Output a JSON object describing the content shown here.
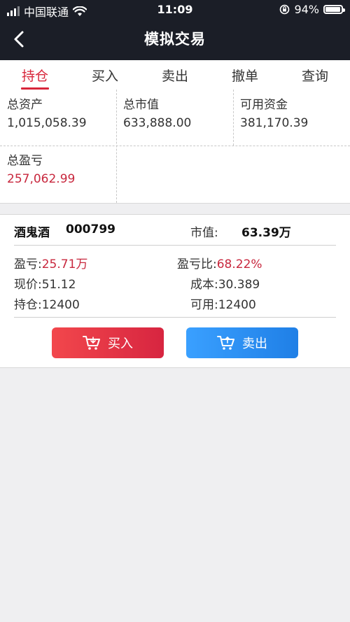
{
  "status_bar": {
    "carrier": "中国联通",
    "time": "11:09",
    "battery_percent": "94%",
    "battery_level": 0.94
  },
  "nav": {
    "title": "模拟交易",
    "back_icon": "chevron-left-icon"
  },
  "tabs": [
    {
      "label": "持仓",
      "active": true
    },
    {
      "label": "买入",
      "active": false
    },
    {
      "label": "卖出",
      "active": false
    },
    {
      "label": "撤单",
      "active": false
    },
    {
      "label": "查询",
      "active": false
    }
  ],
  "account": {
    "total_assets_label": "总资产",
    "total_assets_value": "1,015,058.39",
    "market_value_label": "总市值",
    "market_value_value": "633,888.00",
    "available_funds_label": "可用资金",
    "available_funds_value": "381,170.39",
    "total_pnl_label": "总盈亏",
    "total_pnl_value": "257,062.99"
  },
  "position": {
    "stock_name": "酒鬼酒",
    "stock_code": "000799",
    "market_value_label": "市值:",
    "market_value": "63.39万",
    "pnl_label": "盈亏:",
    "pnl_value": "25.71万",
    "pnl_ratio_label": "盈亏比:",
    "pnl_ratio_value": "68.22%",
    "price_label": "现价:",
    "price_value": "51.12",
    "cost_label": "成本:",
    "cost_value": "30.389",
    "holding_label": "持仓:",
    "holding_value": "12400",
    "available_label": "可用:",
    "available_value": "12400",
    "buy_label": "买入",
    "sell_label": "卖出"
  },
  "colors": {
    "accent_red": "#d8263b",
    "loss_gain_red": "#c8283e",
    "buy_button": "#e33146",
    "sell_button": "#2b8ff3",
    "header_bg": "#1b1e27"
  }
}
